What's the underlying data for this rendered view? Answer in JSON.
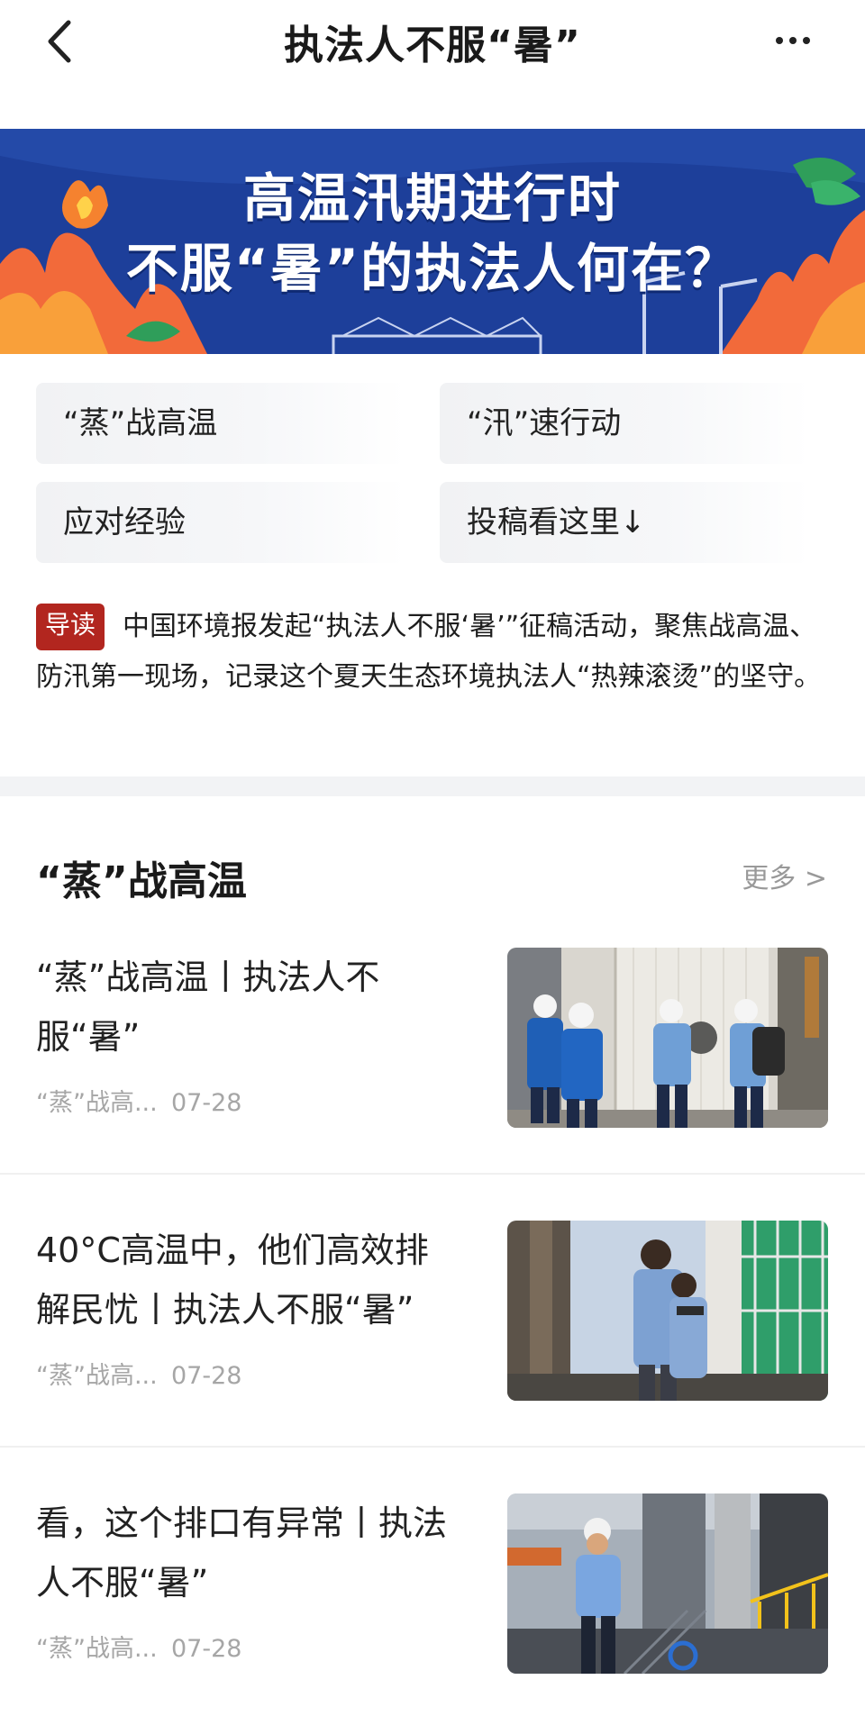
{
  "nav": {
    "title": "执法人不服“暑”"
  },
  "banner": {
    "line1": "高温汛期进行时",
    "line2": "不服“暑”的执法人何在？"
  },
  "categories": [
    {
      "label": "“蒸”战高温"
    },
    {
      "label": "“汛”速行动"
    },
    {
      "label": "应对经验"
    },
    {
      "label": "投稿看这里↓"
    }
  ],
  "intro": {
    "tag": "导读",
    "text": "中国环境报发起“执法人不服‘暑’”征稿活动，聚焦战高温、防汛第一现场，记录这个夏天生态环境执法人“热辣滚烫”的坚守。"
  },
  "section": {
    "title": "“蒸”战高温",
    "more": "更多 >"
  },
  "articles": [
    {
      "title": "“蒸”战高温丨执法人不服“暑”",
      "source": "“蒸”战高...",
      "date": "07-28"
    },
    {
      "title": "40°C高温中，他们高效排解民忧丨执法人不服“暑”",
      "source": "“蒸”战高...",
      "date": "07-28"
    },
    {
      "title": "看，这个排口有异常丨执法人不服“暑”",
      "source": "“蒸”战高...",
      "date": "07-28"
    }
  ],
  "colors": {
    "banner_bg": "#1d3f9a",
    "intro_tag": "#b2261f",
    "meta_gray": "#a6a6a6"
  }
}
